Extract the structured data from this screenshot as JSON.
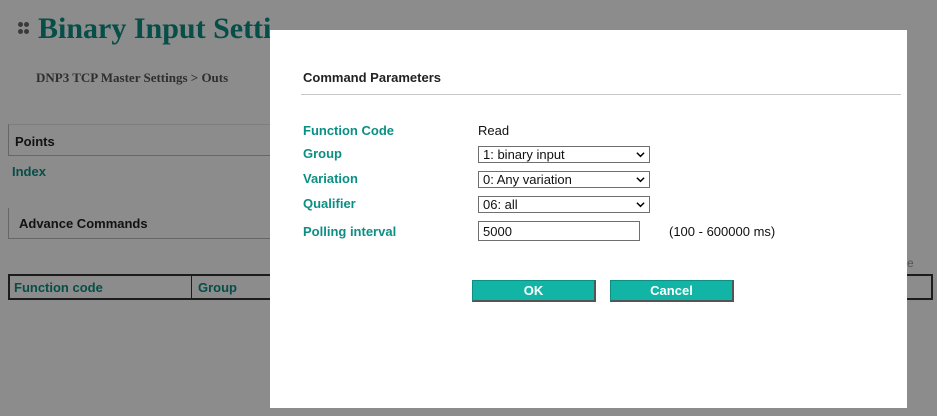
{
  "background": {
    "title": "Binary Input Setti",
    "breadcrumb": "DNP3 TCP Master Settings > Outs",
    "points_section": "Points",
    "index_label": "Index",
    "advance_section": "Advance Commands",
    "table_headers": [
      "Function code",
      "Group"
    ],
    "right_fragment": "e"
  },
  "dialog": {
    "title": "Command Parameters",
    "fields": {
      "function_code": {
        "label": "Function Code",
        "value": "Read"
      },
      "group": {
        "label": "Group",
        "value": "1: binary input"
      },
      "variation": {
        "label": "Variation",
        "value": "0: Any variation"
      },
      "qualifier": {
        "label": "Qualifier",
        "value": "06: all"
      },
      "polling_interval": {
        "label": "Polling interval",
        "value": "5000",
        "hint": "(100 - 600000 ms)"
      }
    },
    "buttons": {
      "ok": "OK",
      "cancel": "Cancel"
    }
  },
  "colors": {
    "accent": "#0b8f84",
    "button": "#12b5a5",
    "overlay": "rgba(0,0,0,0.45)"
  },
  "icons": {
    "select_arrow": "chevron-down-icon",
    "title_bullet": "dots-icon"
  }
}
